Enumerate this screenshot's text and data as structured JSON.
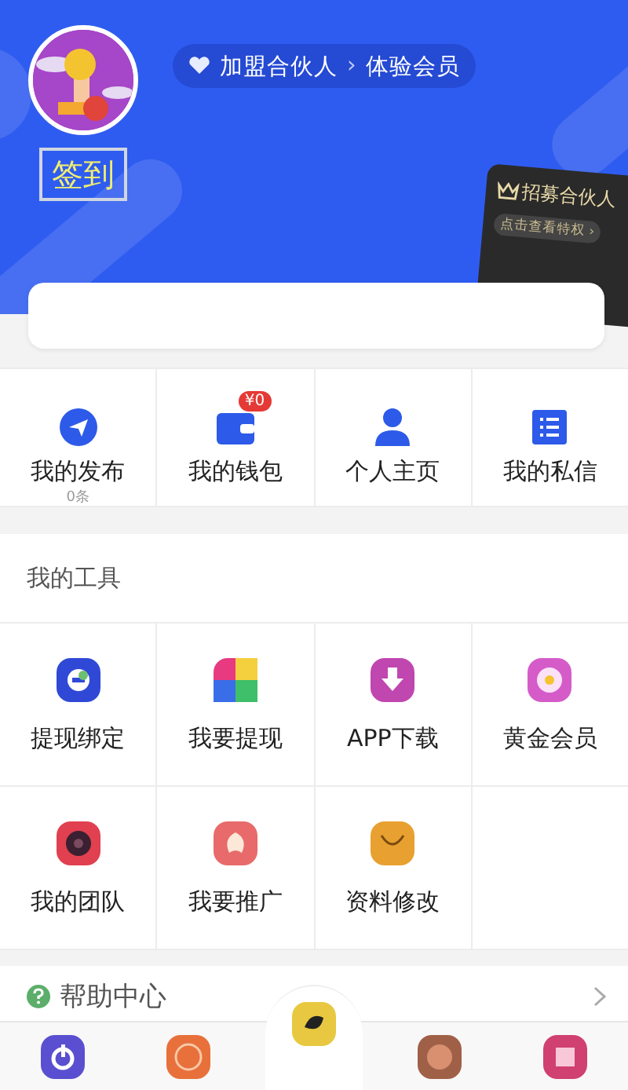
{
  "header": {
    "checkin_button": "签到",
    "breadcrumb": [
      "加盟合伙人",
      "体验会员"
    ],
    "breadcrumb_separator": "›",
    "partner_card": {
      "title": "招募合伙人",
      "link": "点击查看特权 ›"
    }
  },
  "quick_actions": [
    {
      "label": "我的发布",
      "sub": "0条"
    },
    {
      "label": "我的钱包",
      "badge": "¥0"
    },
    {
      "label": "个人主页"
    },
    {
      "label": "我的私信"
    }
  ],
  "tools": {
    "title": "我的工具",
    "items": [
      {
        "label": "提现绑定"
      },
      {
        "label": "我要提现"
      },
      {
        "label": "APP下载"
      },
      {
        "label": "黄金会员"
      },
      {
        "label": "我的团队"
      },
      {
        "label": "我要推广"
      },
      {
        "label": "资料修改"
      }
    ]
  },
  "help": {
    "label": "帮助中心"
  },
  "bottom_nav": [
    {
      "selected": false
    },
    {
      "selected": false
    },
    {
      "selected": false
    },
    {
      "selected": false
    },
    {
      "selected": false
    }
  ]
}
